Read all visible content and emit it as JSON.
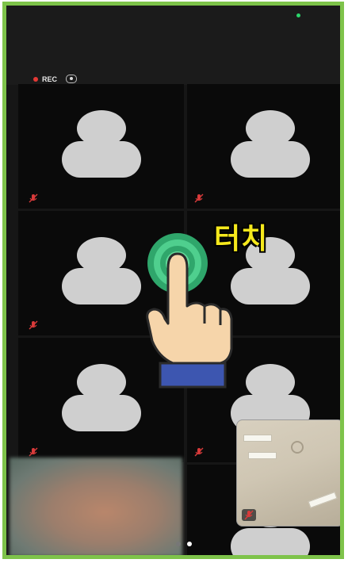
{
  "recording": {
    "label": "REC"
  },
  "overlay": {
    "touch_label": "터치"
  },
  "colors": {
    "frame_border": "#7ec34a",
    "tile_bg": "#0a0a0a",
    "avatar": "#cfcfcf",
    "rec_dot": "#e53935",
    "touch_label": "#f5e81c",
    "ring": "#2fa66b"
  },
  "participants": [
    {
      "avatar": "person-placeholder",
      "muted": true
    },
    {
      "avatar": "person-placeholder",
      "muted": true
    },
    {
      "avatar": "person-placeholder",
      "muted": true
    },
    {
      "avatar": "person-placeholder",
      "muted": true
    },
    {
      "avatar": "person-placeholder",
      "muted": true
    },
    {
      "avatar": "person-placeholder",
      "muted": true
    },
    {
      "avatar": "blurred-video",
      "muted": false
    },
    {
      "avatar": "person-placeholder",
      "muted": false
    }
  ],
  "pager": {
    "pages": 2,
    "current": 2
  },
  "self_view": {
    "muted": true
  }
}
